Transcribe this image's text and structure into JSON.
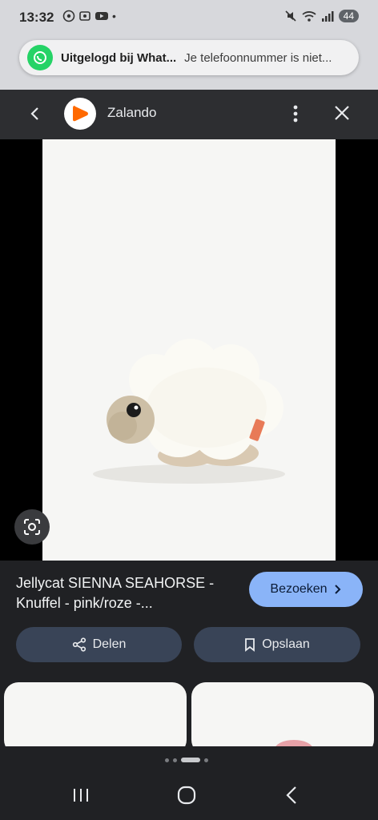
{
  "status": {
    "time": "13:32",
    "battery": "44"
  },
  "toast": {
    "title": "Uitgelogd bij What...",
    "body": "Je telefoonnummer is niet..."
  },
  "header": {
    "title": "Zalando",
    "logo_color": "#ff6900"
  },
  "product": {
    "title": "Jellycat SIENNA SEAHORSE - Knuffel - pink/roze -..."
  },
  "actions": {
    "visit_label": "Bezoeken",
    "share_label": "Delen",
    "save_label": "Opslaan"
  },
  "colors": {
    "accent": "#8ab4f8",
    "pill_bg": "#394457",
    "whatsapp": "#25d366"
  }
}
